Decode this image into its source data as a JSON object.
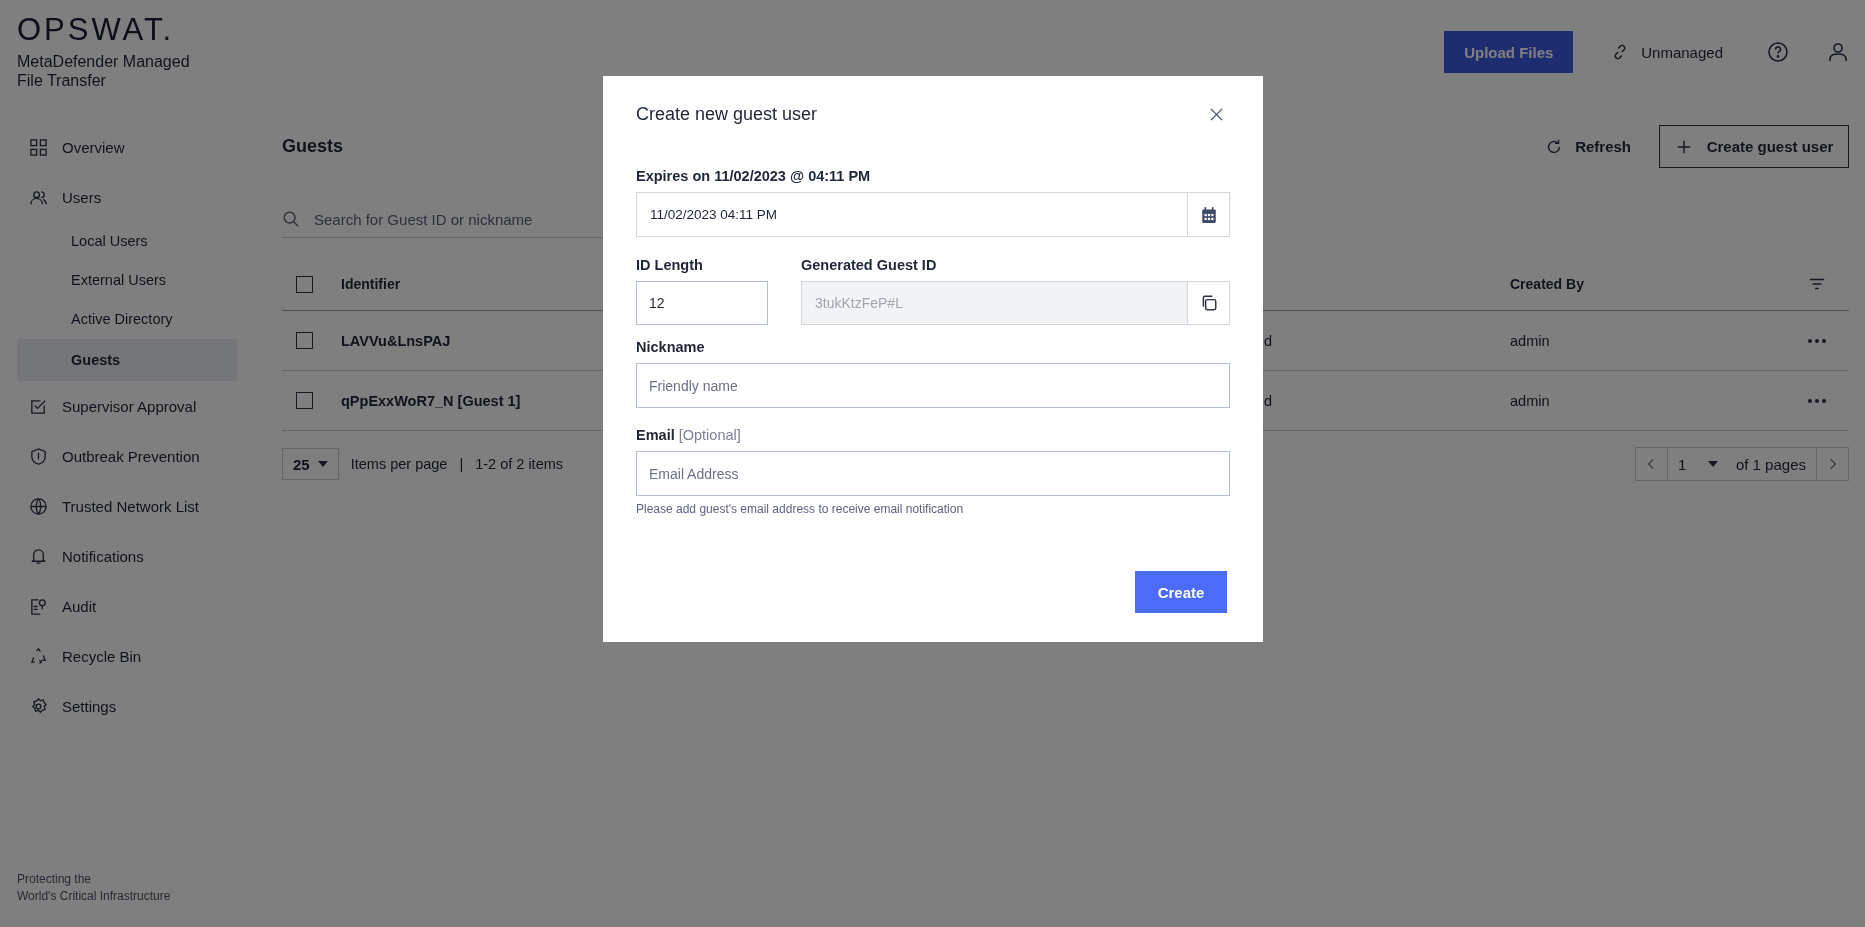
{
  "brand": {
    "logo": "OPSWAT.",
    "product": "MetaDefender Managed File Transfer",
    "tagline_1": "Protecting the",
    "tagline_2": "World's Critical Infrastructure"
  },
  "sidebar": {
    "items": [
      {
        "label": "Overview",
        "selected": false
      },
      {
        "label": "Users",
        "selected": false,
        "children": [
          {
            "label": "Local Users",
            "selected": false
          },
          {
            "label": "External Users",
            "selected": false
          },
          {
            "label": "Active Directory",
            "selected": false
          },
          {
            "label": "Guests",
            "selected": true
          }
        ]
      },
      {
        "label": "Supervisor Approval",
        "selected": false
      },
      {
        "label": "Outbreak Prevention",
        "selected": false
      },
      {
        "label": "Trusted Network List",
        "selected": false
      },
      {
        "label": "Notifications",
        "selected": false
      },
      {
        "label": "Audit",
        "selected": false
      },
      {
        "label": "Recycle Bin",
        "selected": false
      },
      {
        "label": "Settings",
        "selected": false
      }
    ]
  },
  "header": {
    "upload_button": "Upload Files",
    "mode": "Unmanaged"
  },
  "page": {
    "title": "Guests",
    "refresh": "Refresh",
    "create_button": "Create guest user",
    "search": {
      "placeholder": "Search for Guest ID or nickname"
    }
  },
  "table": {
    "select_all_checked": false,
    "columns": [
      "Identifier",
      "Created By"
    ],
    "rows": [
      {
        "checked": false,
        "identifier": "LAVVu&LnsPAJ",
        "column_3": "d",
        "created_by": "admin"
      },
      {
        "checked": false,
        "identifier": "qPpExxWoR7_N [Guest 1]",
        "column_3": "d",
        "created_by": "admin"
      }
    ]
  },
  "pagination": {
    "page_size": "25",
    "items_per_page": "Items per page",
    "separator": "|",
    "range": "1-2 of 2 items",
    "page": "1",
    "of_pages": "of 1 pages"
  },
  "dialog": {
    "title": "Create new guest user",
    "expires_label": "Expires on 11/02/2023 @ 04:11 PM",
    "expires_value": "11/02/2023 04:11 PM",
    "id_length_label": "ID Length",
    "id_length_value": "12",
    "generated_label": "Generated Guest ID",
    "generated_value": "3tukKtzFeP#L",
    "nickname_label": "Nickname",
    "nickname_placeholder": "Friendly name",
    "email_label": "Email",
    "email_note": "[Optional]",
    "email_placeholder": "Email Address",
    "email_hint": "Please add guest's email address to receive email notification",
    "create_button": "Create"
  }
}
